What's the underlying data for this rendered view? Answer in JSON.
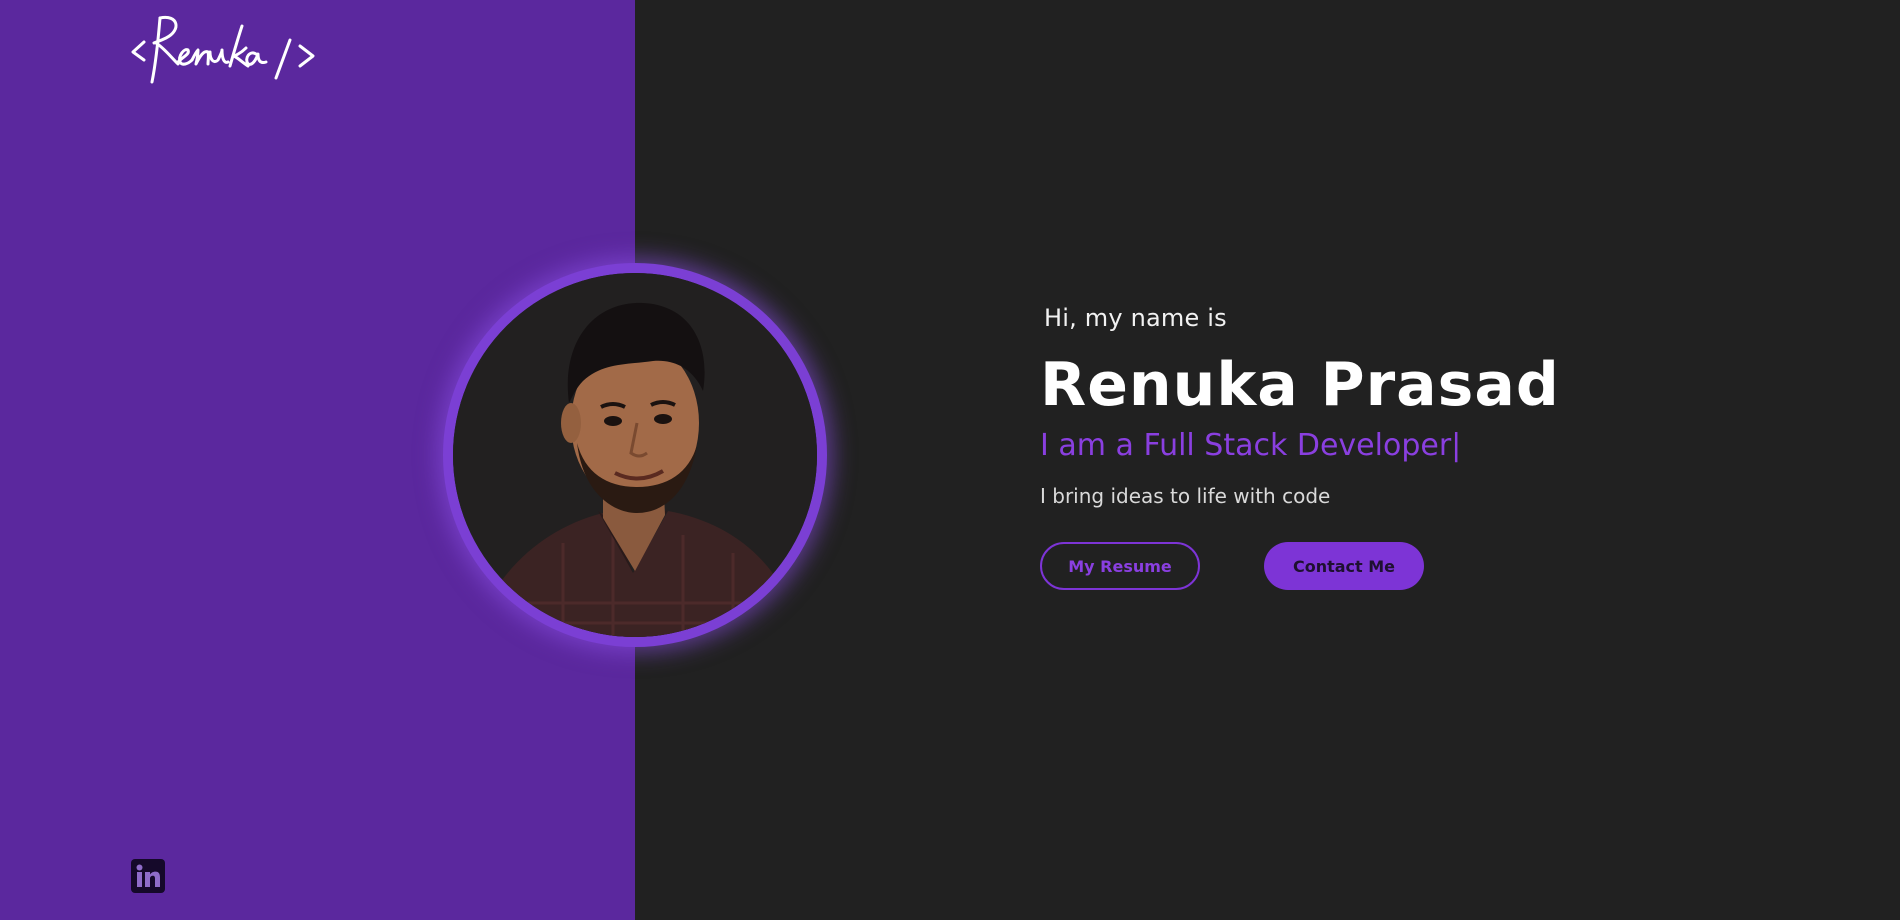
{
  "logo": {
    "text": "<Renuka />"
  },
  "hero": {
    "greeting": "Hi, my name is",
    "name": "Renuka Prasad",
    "role": "I am a Full Stack Developer|",
    "tagline": "I bring ideas to life with code"
  },
  "buttons": {
    "resume_label": "My Resume",
    "contact_label": "Contact Me"
  },
  "social": {
    "linkedin": {
      "icon": "linkedin-icon"
    }
  },
  "colors": {
    "left_panel": "#5b289e",
    "background": "#212121",
    "accent": "#7d34d6",
    "avatar_ring": "#7b3fd4"
  }
}
